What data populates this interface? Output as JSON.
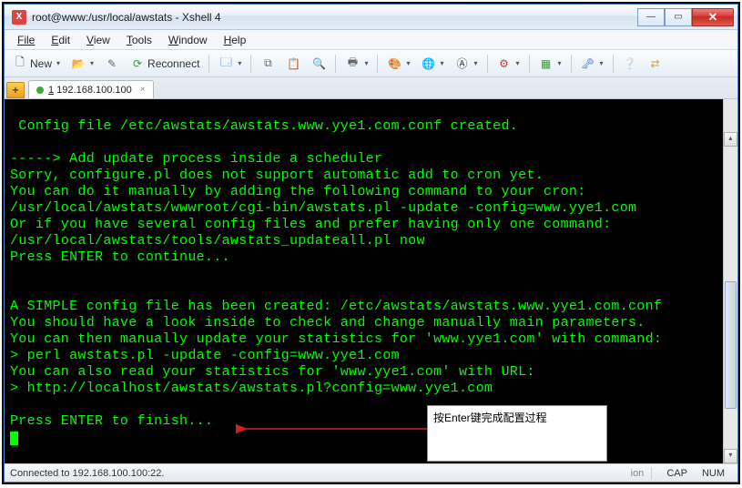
{
  "titlebar": {
    "icon_glyph": "X",
    "title": "root@www:/usr/local/awstats - Xshell 4"
  },
  "winctrl": {
    "min": "—",
    "max": "▭",
    "close": "✕"
  },
  "menu": {
    "file": "File",
    "edit": "Edit",
    "view": "View",
    "tools": "Tools",
    "window": "Window",
    "help": "Help"
  },
  "toolbar": {
    "new": "New",
    "reconnect": "Reconnect"
  },
  "tab": {
    "add": "+",
    "label_prefix": "1",
    "label": " 192.168.100.100",
    "close": "×"
  },
  "terminal_lines": [
    " Config file /etc/awstats/awstats.www.yye1.com.conf created.",
    "",
    "-----> Add update process inside a scheduler",
    "Sorry, configure.pl does not support automatic add to cron yet.",
    "You can do it manually by adding the following command to your cron:",
    "/usr/local/awstats/wwwroot/cgi-bin/awstats.pl -update -config=www.yye1.com",
    "Or if you have several config files and prefer having only one command:",
    "/usr/local/awstats/tools/awstats_updateall.pl now",
    "Press ENTER to continue...",
    "",
    "",
    "A SIMPLE config file has been created: /etc/awstats/awstats.www.yye1.com.conf",
    "You should have a look inside to check and change manually main parameters.",
    "You can then manually update your statistics for 'www.yye1.com' with command:",
    "> perl awstats.pl -update -config=www.yye1.com",
    "You can also read your statistics for 'www.yye1.com' with URL:",
    "> http://localhost/awstats/awstats.pl?config=www.yye1.com",
    "",
    "Press ENTER to finish..."
  ],
  "annotation": {
    "text": "按Enter键完成配置过程"
  },
  "statusbar": {
    "left": "Connected to 192.168.100.100:22.",
    "faded": "ion",
    "cap": "CAP",
    "num": "NUM"
  }
}
